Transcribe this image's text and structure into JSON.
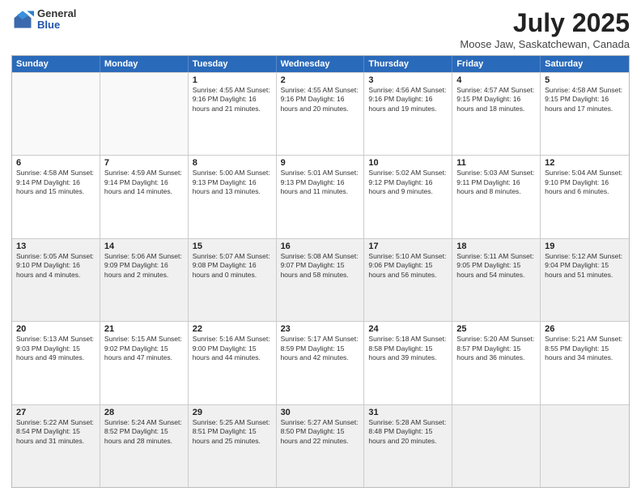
{
  "logo": {
    "general": "General",
    "blue": "Blue"
  },
  "title": "July 2025",
  "subtitle": "Moose Jaw, Saskatchewan, Canada",
  "header_days": [
    "Sunday",
    "Monday",
    "Tuesday",
    "Wednesday",
    "Thursday",
    "Friday",
    "Saturday"
  ],
  "weeks": [
    [
      {
        "day": "",
        "info": "",
        "shaded": false,
        "empty": true
      },
      {
        "day": "",
        "info": "",
        "shaded": false,
        "empty": true
      },
      {
        "day": "1",
        "info": "Sunrise: 4:55 AM\nSunset: 9:16 PM\nDaylight: 16 hours\nand 21 minutes.",
        "shaded": false,
        "empty": false
      },
      {
        "day": "2",
        "info": "Sunrise: 4:55 AM\nSunset: 9:16 PM\nDaylight: 16 hours\nand 20 minutes.",
        "shaded": false,
        "empty": false
      },
      {
        "day": "3",
        "info": "Sunrise: 4:56 AM\nSunset: 9:16 PM\nDaylight: 16 hours\nand 19 minutes.",
        "shaded": false,
        "empty": false
      },
      {
        "day": "4",
        "info": "Sunrise: 4:57 AM\nSunset: 9:15 PM\nDaylight: 16 hours\nand 18 minutes.",
        "shaded": false,
        "empty": false
      },
      {
        "day": "5",
        "info": "Sunrise: 4:58 AM\nSunset: 9:15 PM\nDaylight: 16 hours\nand 17 minutes.",
        "shaded": false,
        "empty": false
      }
    ],
    [
      {
        "day": "6",
        "info": "Sunrise: 4:58 AM\nSunset: 9:14 PM\nDaylight: 16 hours\nand 15 minutes.",
        "shaded": false,
        "empty": false
      },
      {
        "day": "7",
        "info": "Sunrise: 4:59 AM\nSunset: 9:14 PM\nDaylight: 16 hours\nand 14 minutes.",
        "shaded": false,
        "empty": false
      },
      {
        "day": "8",
        "info": "Sunrise: 5:00 AM\nSunset: 9:13 PM\nDaylight: 16 hours\nand 13 minutes.",
        "shaded": false,
        "empty": false
      },
      {
        "day": "9",
        "info": "Sunrise: 5:01 AM\nSunset: 9:13 PM\nDaylight: 16 hours\nand 11 minutes.",
        "shaded": false,
        "empty": false
      },
      {
        "day": "10",
        "info": "Sunrise: 5:02 AM\nSunset: 9:12 PM\nDaylight: 16 hours\nand 9 minutes.",
        "shaded": false,
        "empty": false
      },
      {
        "day": "11",
        "info": "Sunrise: 5:03 AM\nSunset: 9:11 PM\nDaylight: 16 hours\nand 8 minutes.",
        "shaded": false,
        "empty": false
      },
      {
        "day": "12",
        "info": "Sunrise: 5:04 AM\nSunset: 9:10 PM\nDaylight: 16 hours\nand 6 minutes.",
        "shaded": false,
        "empty": false
      }
    ],
    [
      {
        "day": "13",
        "info": "Sunrise: 5:05 AM\nSunset: 9:10 PM\nDaylight: 16 hours\nand 4 minutes.",
        "shaded": true,
        "empty": false
      },
      {
        "day": "14",
        "info": "Sunrise: 5:06 AM\nSunset: 9:09 PM\nDaylight: 16 hours\nand 2 minutes.",
        "shaded": true,
        "empty": false
      },
      {
        "day": "15",
        "info": "Sunrise: 5:07 AM\nSunset: 9:08 PM\nDaylight: 16 hours\nand 0 minutes.",
        "shaded": true,
        "empty": false
      },
      {
        "day": "16",
        "info": "Sunrise: 5:08 AM\nSunset: 9:07 PM\nDaylight: 15 hours\nand 58 minutes.",
        "shaded": true,
        "empty": false
      },
      {
        "day": "17",
        "info": "Sunrise: 5:10 AM\nSunset: 9:06 PM\nDaylight: 15 hours\nand 56 minutes.",
        "shaded": true,
        "empty": false
      },
      {
        "day": "18",
        "info": "Sunrise: 5:11 AM\nSunset: 9:05 PM\nDaylight: 15 hours\nand 54 minutes.",
        "shaded": true,
        "empty": false
      },
      {
        "day": "19",
        "info": "Sunrise: 5:12 AM\nSunset: 9:04 PM\nDaylight: 15 hours\nand 51 minutes.",
        "shaded": true,
        "empty": false
      }
    ],
    [
      {
        "day": "20",
        "info": "Sunrise: 5:13 AM\nSunset: 9:03 PM\nDaylight: 15 hours\nand 49 minutes.",
        "shaded": false,
        "empty": false
      },
      {
        "day": "21",
        "info": "Sunrise: 5:15 AM\nSunset: 9:02 PM\nDaylight: 15 hours\nand 47 minutes.",
        "shaded": false,
        "empty": false
      },
      {
        "day": "22",
        "info": "Sunrise: 5:16 AM\nSunset: 9:00 PM\nDaylight: 15 hours\nand 44 minutes.",
        "shaded": false,
        "empty": false
      },
      {
        "day": "23",
        "info": "Sunrise: 5:17 AM\nSunset: 8:59 PM\nDaylight: 15 hours\nand 42 minutes.",
        "shaded": false,
        "empty": false
      },
      {
        "day": "24",
        "info": "Sunrise: 5:18 AM\nSunset: 8:58 PM\nDaylight: 15 hours\nand 39 minutes.",
        "shaded": false,
        "empty": false
      },
      {
        "day": "25",
        "info": "Sunrise: 5:20 AM\nSunset: 8:57 PM\nDaylight: 15 hours\nand 36 minutes.",
        "shaded": false,
        "empty": false
      },
      {
        "day": "26",
        "info": "Sunrise: 5:21 AM\nSunset: 8:55 PM\nDaylight: 15 hours\nand 34 minutes.",
        "shaded": false,
        "empty": false
      }
    ],
    [
      {
        "day": "27",
        "info": "Sunrise: 5:22 AM\nSunset: 8:54 PM\nDaylight: 15 hours\nand 31 minutes.",
        "shaded": true,
        "empty": false
      },
      {
        "day": "28",
        "info": "Sunrise: 5:24 AM\nSunset: 8:52 PM\nDaylight: 15 hours\nand 28 minutes.",
        "shaded": true,
        "empty": false
      },
      {
        "day": "29",
        "info": "Sunrise: 5:25 AM\nSunset: 8:51 PM\nDaylight: 15 hours\nand 25 minutes.",
        "shaded": true,
        "empty": false
      },
      {
        "day": "30",
        "info": "Sunrise: 5:27 AM\nSunset: 8:50 PM\nDaylight: 15 hours\nand 22 minutes.",
        "shaded": true,
        "empty": false
      },
      {
        "day": "31",
        "info": "Sunrise: 5:28 AM\nSunset: 8:48 PM\nDaylight: 15 hours\nand 20 minutes.",
        "shaded": true,
        "empty": false
      },
      {
        "day": "",
        "info": "",
        "shaded": true,
        "empty": true
      },
      {
        "day": "",
        "info": "",
        "shaded": true,
        "empty": true
      }
    ]
  ]
}
